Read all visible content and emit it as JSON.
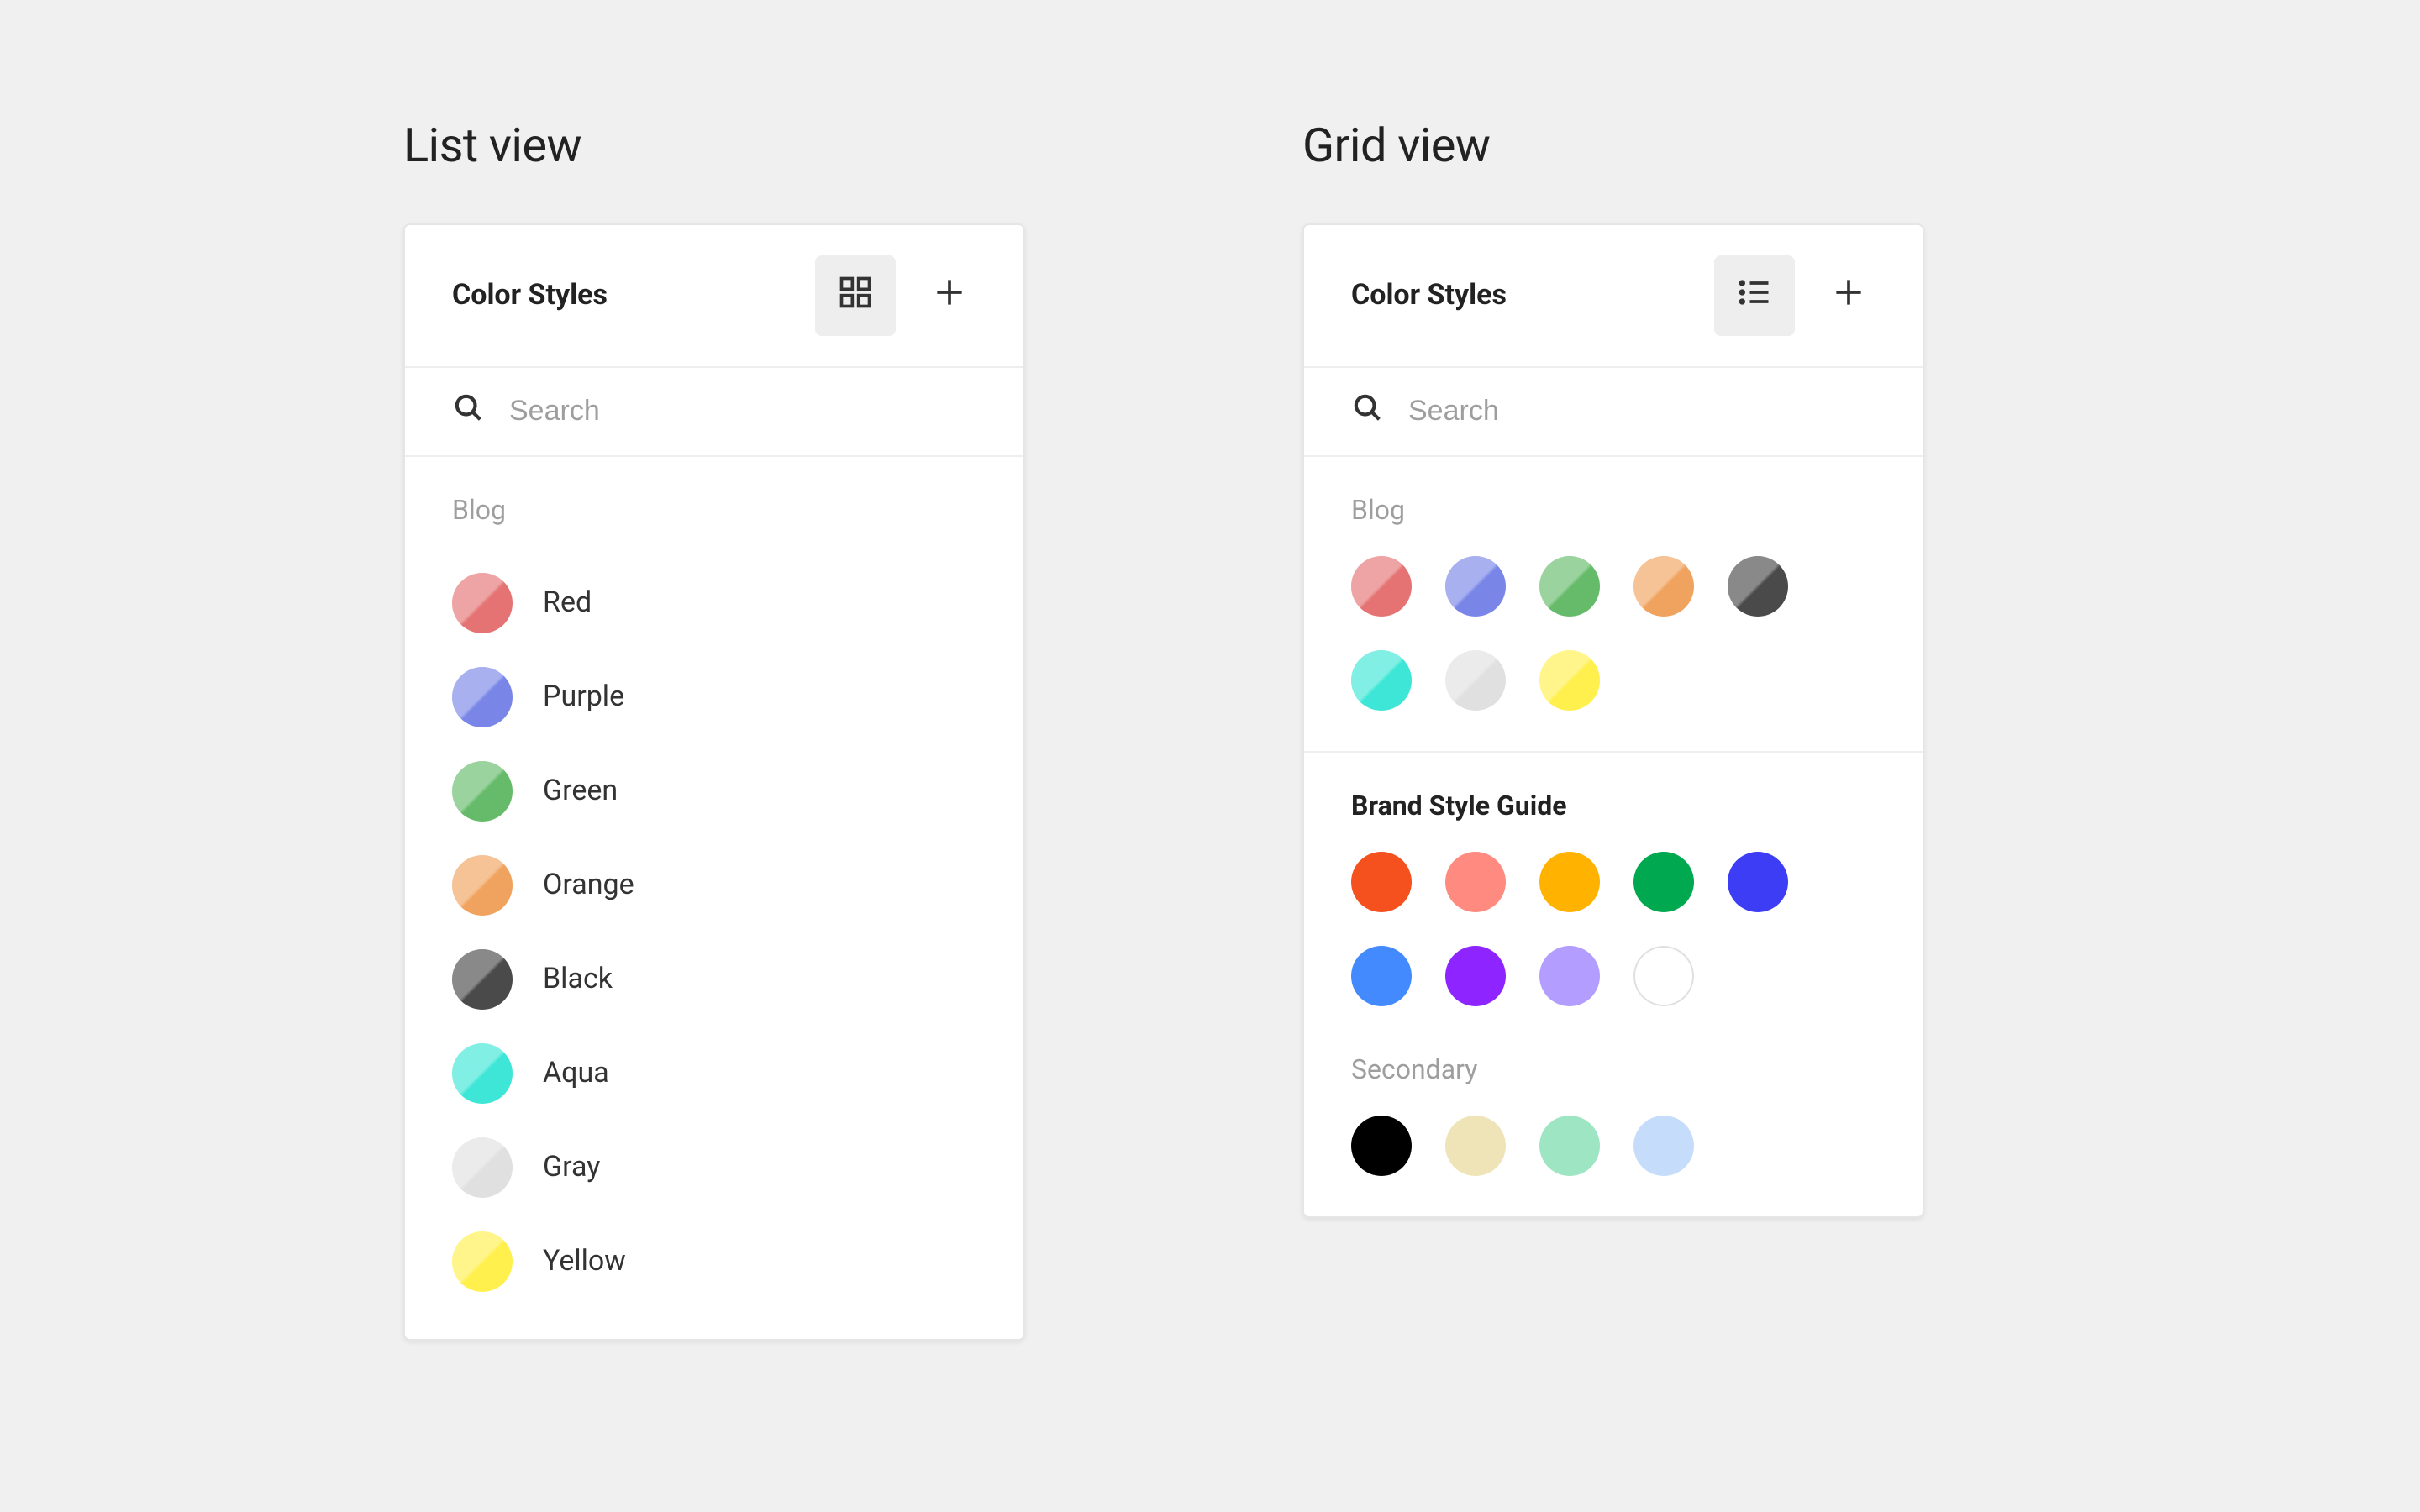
{
  "listView": {
    "heading": "List view",
    "panelTitle": "Color Styles",
    "searchPlaceholder": "Search",
    "group": {
      "title": "Blog",
      "items": [
        {
          "label": "Red",
          "color": "#e57373",
          "tex": true
        },
        {
          "label": "Purple",
          "color": "#7986e8",
          "tex": true
        },
        {
          "label": "Green",
          "color": "#66bb6a",
          "tex": true
        },
        {
          "label": "Orange",
          "color": "#f0a35e",
          "tex": true
        },
        {
          "label": "Black",
          "color": "#4a4a4a",
          "tex": true
        },
        {
          "label": "Aqua",
          "color": "#3de6d6",
          "tex": true
        },
        {
          "label": "Gray",
          "color": "#e0e0e0",
          "tex": true
        },
        {
          "label": "Yellow",
          "color": "#fff04d",
          "tex": true
        }
      ]
    }
  },
  "gridView": {
    "heading": "Grid view",
    "panelTitle": "Color Styles",
    "searchPlaceholder": "Search",
    "groups": [
      {
        "title": "Blog",
        "strong": false,
        "swatches": [
          {
            "color": "#e57373",
            "tex": true
          },
          {
            "color": "#7986e8",
            "tex": true
          },
          {
            "color": "#66bb6a",
            "tex": true
          },
          {
            "color": "#f0a35e",
            "tex": true
          },
          {
            "color": "#4a4a4a",
            "tex": true
          },
          {
            "color": "#3de6d6",
            "tex": true
          },
          {
            "color": "#e0e0e0",
            "tex": true
          },
          {
            "color": "#fff04d",
            "tex": true
          }
        ]
      },
      {
        "title": "Brand Style Guide",
        "strong": true,
        "swatches": [
          {
            "color": "#f4511e"
          },
          {
            "color": "#ff8a80"
          },
          {
            "color": "#ffb300"
          },
          {
            "color": "#00a94f"
          },
          {
            "color": "#3d3df5"
          },
          {
            "color": "#448aff"
          },
          {
            "color": "#8e24ff"
          },
          {
            "color": "#b39dff"
          },
          {
            "color": "#ffffff",
            "bordered": true
          }
        ],
        "subgroup": {
          "title": "Secondary",
          "swatches": [
            {
              "color": "#000000"
            },
            {
              "color": "#eee4b8"
            },
            {
              "color": "#9ee6c3"
            },
            {
              "color": "#c5ddfb"
            }
          ]
        }
      }
    ]
  }
}
